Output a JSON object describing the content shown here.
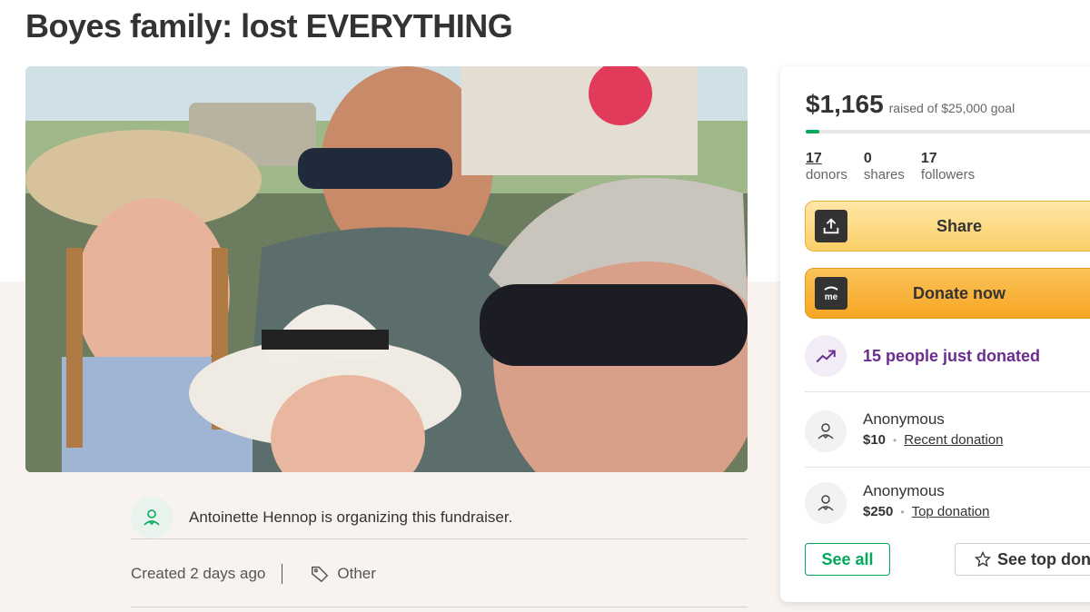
{
  "page": {
    "title": "Boyes family: lost EVERYTHING"
  },
  "photo": {
    "alt": "family-photo"
  },
  "organizer": {
    "text": "Antoinette Hennop is organizing this fundraiser."
  },
  "meta": {
    "created": "Created 2 days ago",
    "category": "Other"
  },
  "card": {
    "amount": "$1,165",
    "goal": "raised of $25,000 goal",
    "progress_percent": 4.66,
    "stats": [
      {
        "num": "17",
        "label": "donors",
        "underlined": true
      },
      {
        "num": "0",
        "label": "shares",
        "underlined": false
      },
      {
        "num": "17",
        "label": "followers",
        "underlined": false
      }
    ],
    "share_label": "Share",
    "donate_label": "Donate now",
    "trend_text": "15 people just donated",
    "donations": [
      {
        "name": "Anonymous",
        "amount": "$10",
        "dot": "•",
        "kind": "Recent donation"
      },
      {
        "name": "Anonymous",
        "amount": "$250",
        "dot": "•",
        "kind": "Top donation"
      }
    ],
    "see_all_label": "See all",
    "see_top_label": "See top dona"
  },
  "colors": {
    "accent_green": "#02a95c",
    "share_yellow": "#fbcf68",
    "donate_orange": "#f6a623",
    "trend_purple": "#6b2c91"
  },
  "icons": [
    "upload-icon",
    "gofundme-logo-icon",
    "trending-up-icon",
    "heart-hand-icon",
    "tag-icon",
    "star-icon"
  ]
}
